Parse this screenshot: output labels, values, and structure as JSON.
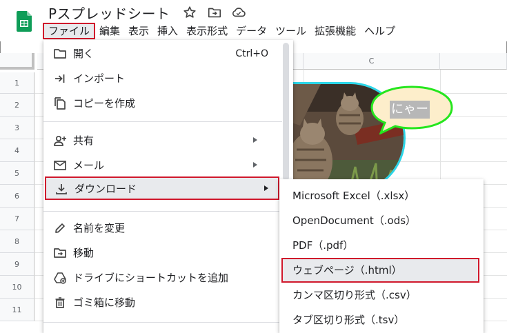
{
  "app": {
    "doc_title": "Pスプレッドシート"
  },
  "menubar": {
    "items": [
      "ファイル",
      "編集",
      "表示",
      "挿入",
      "表示形式",
      "データ",
      "ツール",
      "拡張機能",
      "ヘルプ"
    ]
  },
  "grid": {
    "col_header_c": "C",
    "rows": [
      "1",
      "2",
      "3",
      "4",
      "5",
      "6",
      "7",
      "8",
      "9",
      "10",
      "11"
    ]
  },
  "bubble": {
    "text": "にゃー"
  },
  "file_menu": {
    "open": {
      "label": "開く",
      "shortcut": "Ctrl+O"
    },
    "import": "インポート",
    "copy": "コピーを作成",
    "share": "共有",
    "email": "メール",
    "download": "ダウンロード",
    "rename": "名前を変更",
    "move": "移動",
    "shortcut": "ドライブにショートカットを追加",
    "trash": "ゴミ箱に移動"
  },
  "download_menu": {
    "items": [
      "Microsoft Excel（.xlsx）",
      "OpenDocument（.ods）",
      "PDF（.pdf）",
      "ウェブページ（.html）",
      "カンマ区切り形式（.csv）",
      "タブ区切り形式（.tsv）"
    ]
  },
  "colors": {
    "highlight_border": "#d0182c",
    "sheets_green": "#0f9d58",
    "bubble_green": "#25e61e",
    "bubble_fill": "#fdeecb",
    "image_border": "#2bd6e8"
  }
}
